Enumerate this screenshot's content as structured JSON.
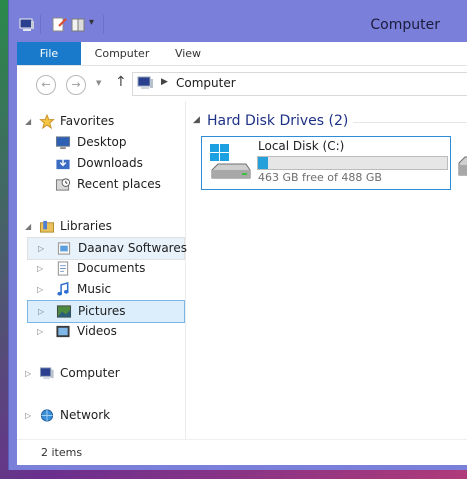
{
  "window": {
    "title": "Computer"
  },
  "quick_access": [
    {
      "name": "pc-system-icon"
    },
    {
      "name": "properties-icon"
    },
    {
      "name": "new-folder-icon"
    },
    {
      "name": "customize-dropdown-icon"
    }
  ],
  "tabs": {
    "file": "File",
    "computer": "Computer",
    "view": "View"
  },
  "address": {
    "back": "←",
    "forward": "→",
    "up": "↑",
    "separator": "▶",
    "location": "Computer"
  },
  "nav": {
    "favorites": "Favorites",
    "desktop": "Desktop",
    "downloads": "Downloads",
    "recent": "Recent places",
    "libraries": "Libraries",
    "daanav": "Daanav Softwares",
    "documents": "Documents",
    "music": "Music",
    "pictures": "Pictures",
    "videos": "Videos",
    "computer": "Computer",
    "network": "Network"
  },
  "main": {
    "group_header": "Hard Disk Drives (2)",
    "drive": {
      "label": "Local Disk (C:)",
      "free": "463 GB free of 488 GB",
      "used_fraction": 0.051
    }
  },
  "status": {
    "items": "2 items"
  },
  "colors": {
    "accent": "#1979ca",
    "frame": "#7a7fd9",
    "selection_bg": "#dceefb",
    "selection_border": "#7ab7e6",
    "progress": "#26a0da",
    "header_text": "#1e3287"
  }
}
